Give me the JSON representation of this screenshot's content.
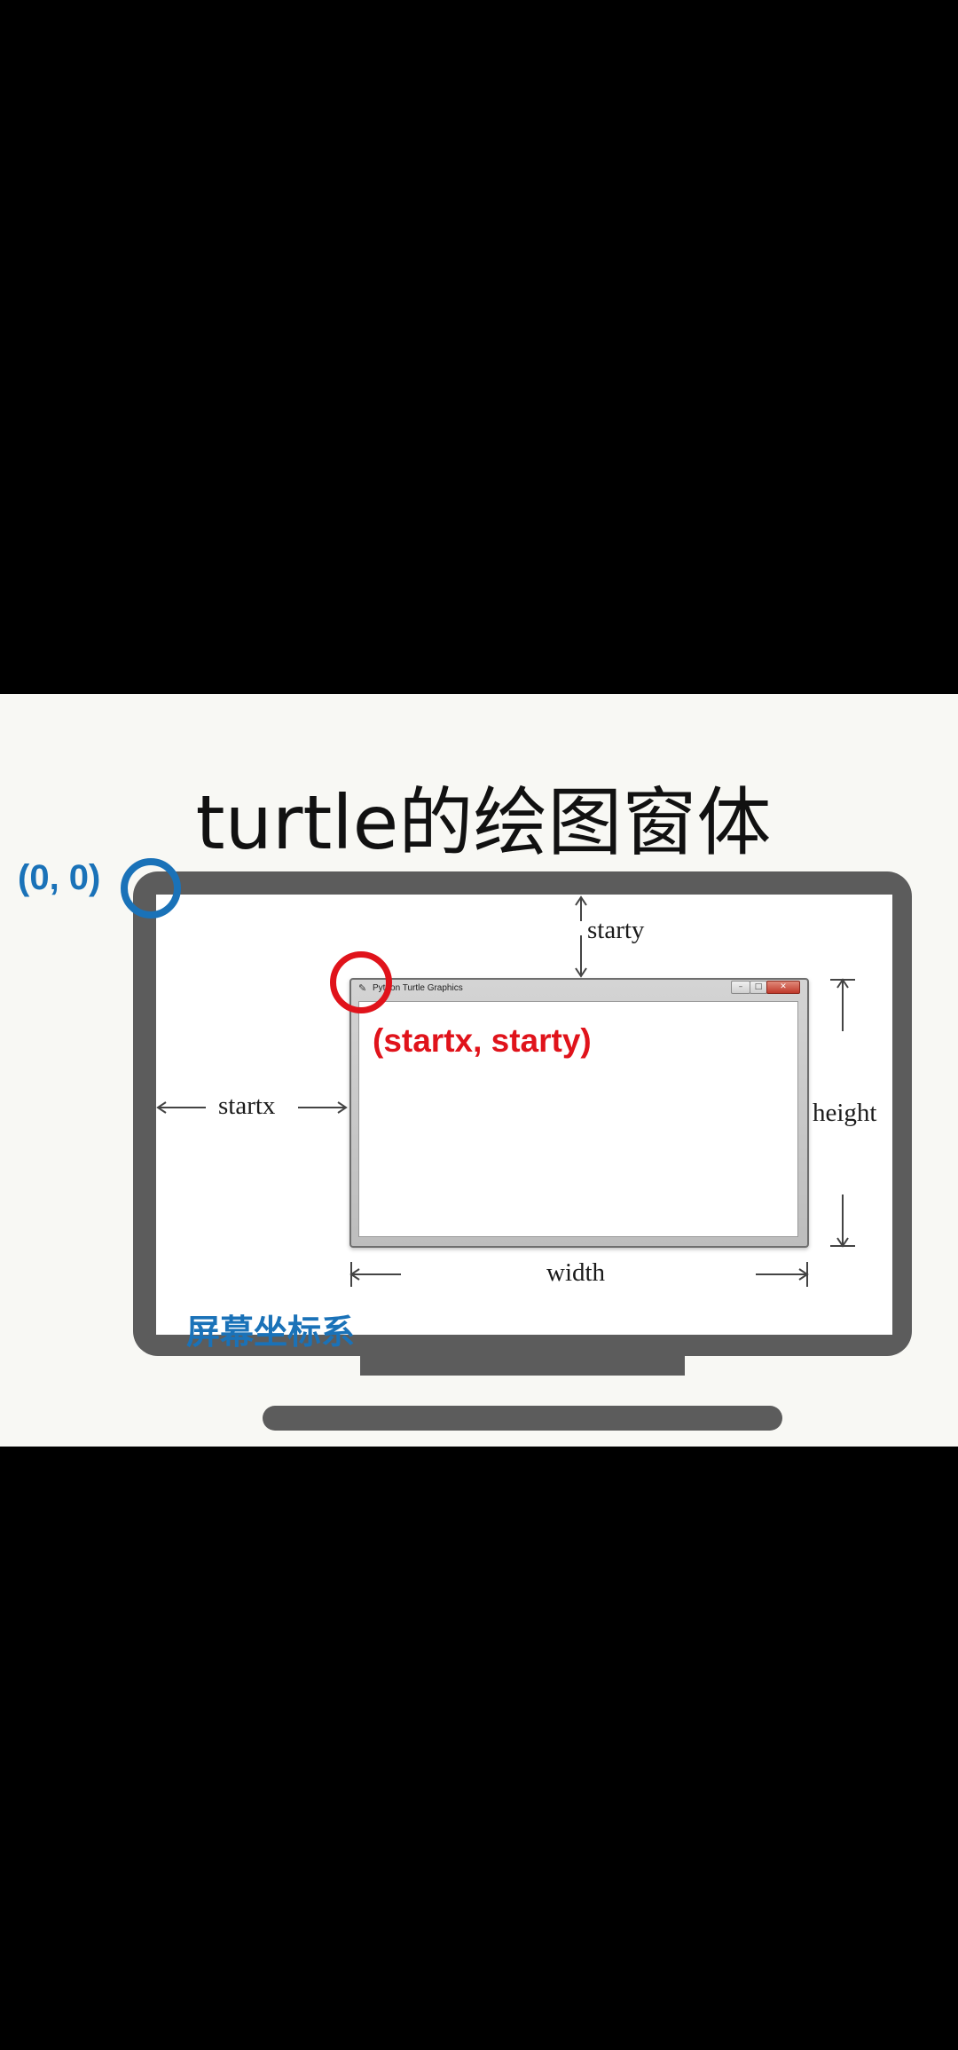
{
  "title": "turtle的绘图窗体",
  "origin_label": "(0, 0)",
  "start_label": "(startx, starty)",
  "window_title": "Python Turtle Graphics",
  "labels": {
    "startx": "startx",
    "starty": "starty",
    "width": "width",
    "height": "height"
  },
  "coordinate_system": "屏幕坐标系",
  "colors": {
    "origin": "#1a72b8",
    "start": "#e0131b",
    "monitor": "#5c5c5c"
  }
}
